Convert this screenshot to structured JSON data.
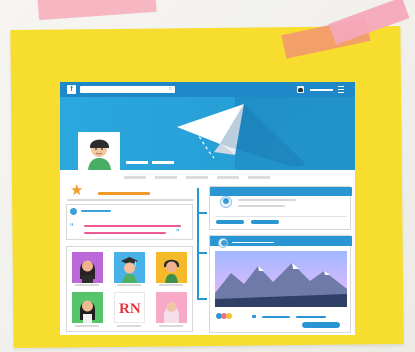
{
  "header": {
    "fb_icon": "f",
    "search_icon": "⌕"
  },
  "posts": {
    "quote_left": "“",
    "quote_right": "”"
  },
  "tiles": {
    "logo_text": "RN"
  },
  "icons": {
    "star": "★"
  }
}
